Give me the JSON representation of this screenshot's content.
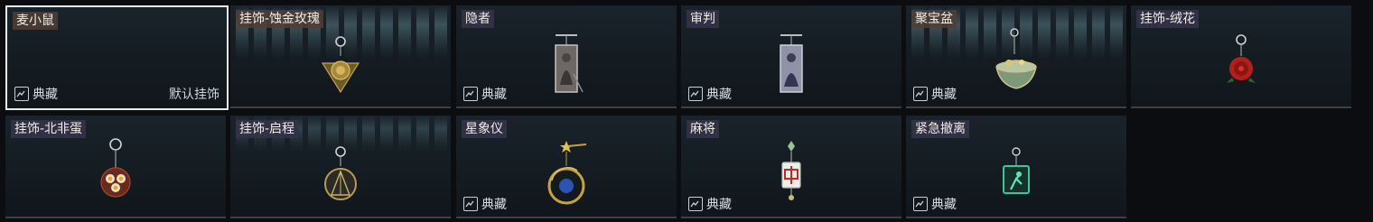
{
  "cards": [
    {
      "name": "麦小鼠",
      "collection": "典藏",
      "default_tag": "默认挂饰",
      "selected": true,
      "icon": "none"
    },
    {
      "name": "挂饰-蚀金玫瑰",
      "collection": "",
      "icon": "rose-gold-charm-icon"
    },
    {
      "name": "隐者",
      "collection": "典藏",
      "icon": "hermit-card-icon"
    },
    {
      "name": "审判",
      "collection": "典藏",
      "icon": "judgement-card-icon"
    },
    {
      "name": "聚宝盆",
      "collection": "典藏",
      "icon": "treasure-bowl-icon"
    },
    {
      "name": "挂饰-绒花",
      "collection": "",
      "icon": "velvet-flower-icon"
    },
    {
      "name": "挂饰-北非蛋",
      "collection": "",
      "icon": "shakshuka-pan-icon"
    },
    {
      "name": "挂饰-启程",
      "collection": "",
      "icon": "compass-pendant-icon"
    },
    {
      "name": "星象仪",
      "collection": "典藏",
      "icon": "astrolabe-icon"
    },
    {
      "name": "麻将",
      "collection": "典藏",
      "icon": "mahjong-tile-icon"
    },
    {
      "name": "紧急撤离",
      "collection": "典藏",
      "icon": "emergency-exit-icon"
    }
  ]
}
